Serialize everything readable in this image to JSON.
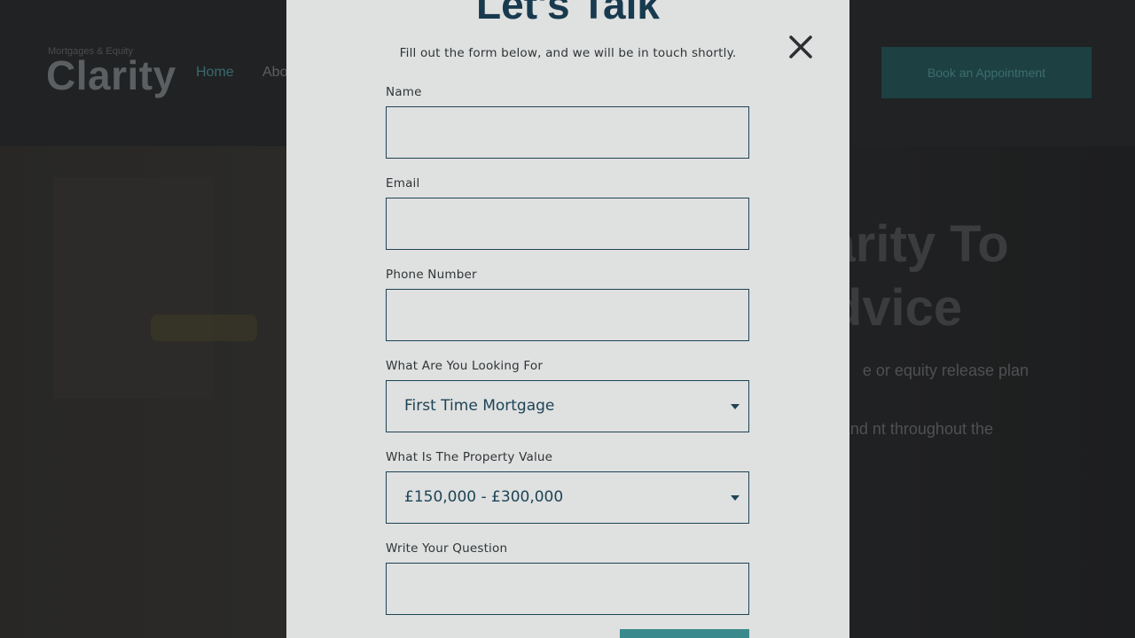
{
  "background": {
    "logo_tagline": "Mortgages & Equity",
    "logo": "Clarity",
    "nav": [
      "Home",
      "About"
    ],
    "book_button": "Book an Appointment",
    "hero_title": "Bringing Clarity To Mortgage Advice",
    "hero_p1": "e or equity release plan",
    "hero_p2": "ur needs, aims and nt throughout the"
  },
  "modal": {
    "title": "Let's Talk",
    "subtitle": "Fill out the form below, and we will be in touch shortly.",
    "close_icon": "close-icon",
    "fields": {
      "name_label": "Name",
      "name_value": "",
      "email_label": "Email",
      "email_value": "",
      "phone_label": "Phone Number",
      "phone_value": "",
      "looking_for_label": "What Are You Looking For",
      "looking_for_value": "First Time Mortgage",
      "property_value_label": "What Is The Property Value",
      "property_value_value": "£150,000 - £300,000",
      "question_label": "Write Your Question",
      "question_value": ""
    }
  },
  "colors": {
    "accent": "#1e4456",
    "title": "#183a4f",
    "button": "#3a8a8d"
  }
}
